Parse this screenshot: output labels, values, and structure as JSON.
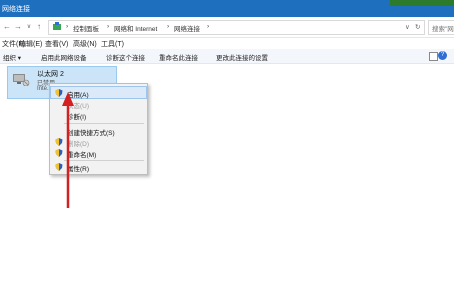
{
  "window": {
    "title": "网络连接"
  },
  "address": {
    "segments": [
      "控制面板",
      "网络和 Internet",
      "网络连接"
    ],
    "search_placeholder": "搜索\"网络连接\""
  },
  "menu": {
    "items": [
      "文件(F)",
      "编辑(E)",
      "查看(V)",
      "高级(N)",
      "工具(T)"
    ]
  },
  "commands": {
    "items": [
      "组织 ▾",
      "启用此网络设备",
      "诊断这个连接",
      "重命名此连接",
      "更改此连接的设置"
    ]
  },
  "adapter": {
    "name": "以太网 2",
    "status": "已禁用",
    "description": "Inte..."
  },
  "context_menu": {
    "items": [
      {
        "label": "启用(A)",
        "shield": true,
        "highlighted": true,
        "disabled": false
      },
      {
        "label": "状态(U)",
        "shield": false,
        "highlighted": false,
        "disabled": true
      },
      {
        "label": "诊断(I)",
        "shield": false,
        "highlighted": false,
        "disabled": false
      },
      {
        "label": "创建快捷方式(S)",
        "shield": false,
        "highlighted": false,
        "disabled": false
      },
      {
        "label": "删除(D)",
        "shield": true,
        "highlighted": false,
        "disabled": true
      },
      {
        "label": "重命名(M)",
        "shield": true,
        "highlighted": false,
        "disabled": false
      },
      {
        "label": "属性(R)",
        "shield": true,
        "highlighted": false,
        "disabled": false
      }
    ]
  },
  "colors": {
    "titlebar": "#1f6fbf",
    "selection": "#cce4f7",
    "annotation_arrow": "#d42020"
  }
}
